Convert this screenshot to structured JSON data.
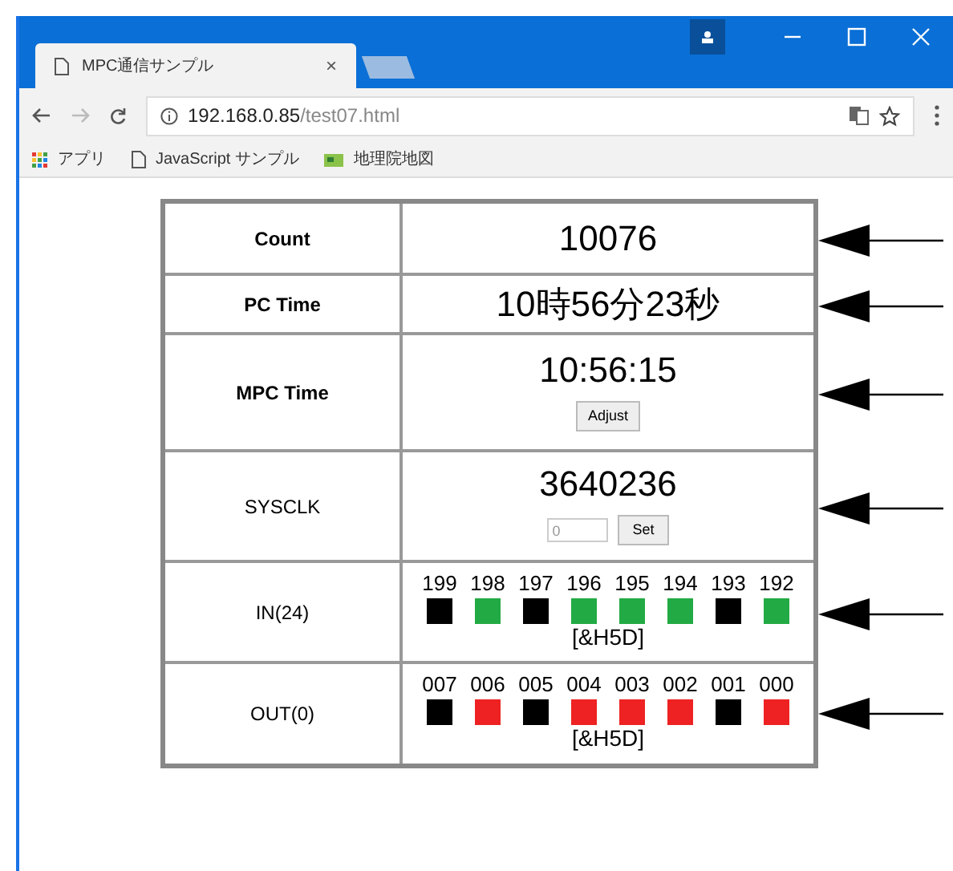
{
  "browser": {
    "tab_title": "MPC通信サンプル",
    "tab_close": "×",
    "url_host": "192.168.0.85",
    "url_path": "/test07.html",
    "bookmarks": [
      {
        "kind": "apps",
        "label": "アプリ"
      },
      {
        "kind": "page",
        "label": "JavaScript サンプル"
      },
      {
        "kind": "map",
        "label": "地理院地図"
      }
    ]
  },
  "rows": [
    {
      "kind": "value",
      "label": "Count",
      "value": "10076"
    },
    {
      "kind": "value",
      "label": "PC Time",
      "value": "10時56分23秒"
    },
    {
      "kind": "button",
      "label": "MPC Time",
      "value": "10:56:15",
      "button": "Adjust"
    },
    {
      "kind": "input",
      "label": "SYSCLK",
      "value": "3640236",
      "field_value": "0",
      "button": "Set"
    },
    {
      "kind": "bits",
      "label": "IN(24)",
      "bits": [
        {
          "label": "199",
          "color": "#000000"
        },
        {
          "label": "198",
          "color": "#22aa44"
        },
        {
          "label": "197",
          "color": "#000000"
        },
        {
          "label": "196",
          "color": "#22aa44"
        },
        {
          "label": "195",
          "color": "#22aa44"
        },
        {
          "label": "194",
          "color": "#22aa44"
        },
        {
          "label": "193",
          "color": "#000000"
        },
        {
          "label": "192",
          "color": "#22aa44"
        }
      ],
      "hex": "[&H5D]"
    },
    {
      "kind": "bits",
      "label": "OUT(0)",
      "bits": [
        {
          "label": "007",
          "color": "#000000"
        },
        {
          "label": "006",
          "color": "#ee2222"
        },
        {
          "label": "005",
          "color": "#000000"
        },
        {
          "label": "004",
          "color": "#ee2222"
        },
        {
          "label": "003",
          "color": "#ee2222"
        },
        {
          "label": "002",
          "color": "#ee2222"
        },
        {
          "label": "001",
          "color": "#000000"
        },
        {
          "label": "000",
          "color": "#ee2222"
        }
      ],
      "hex": "[&H5D]"
    }
  ]
}
